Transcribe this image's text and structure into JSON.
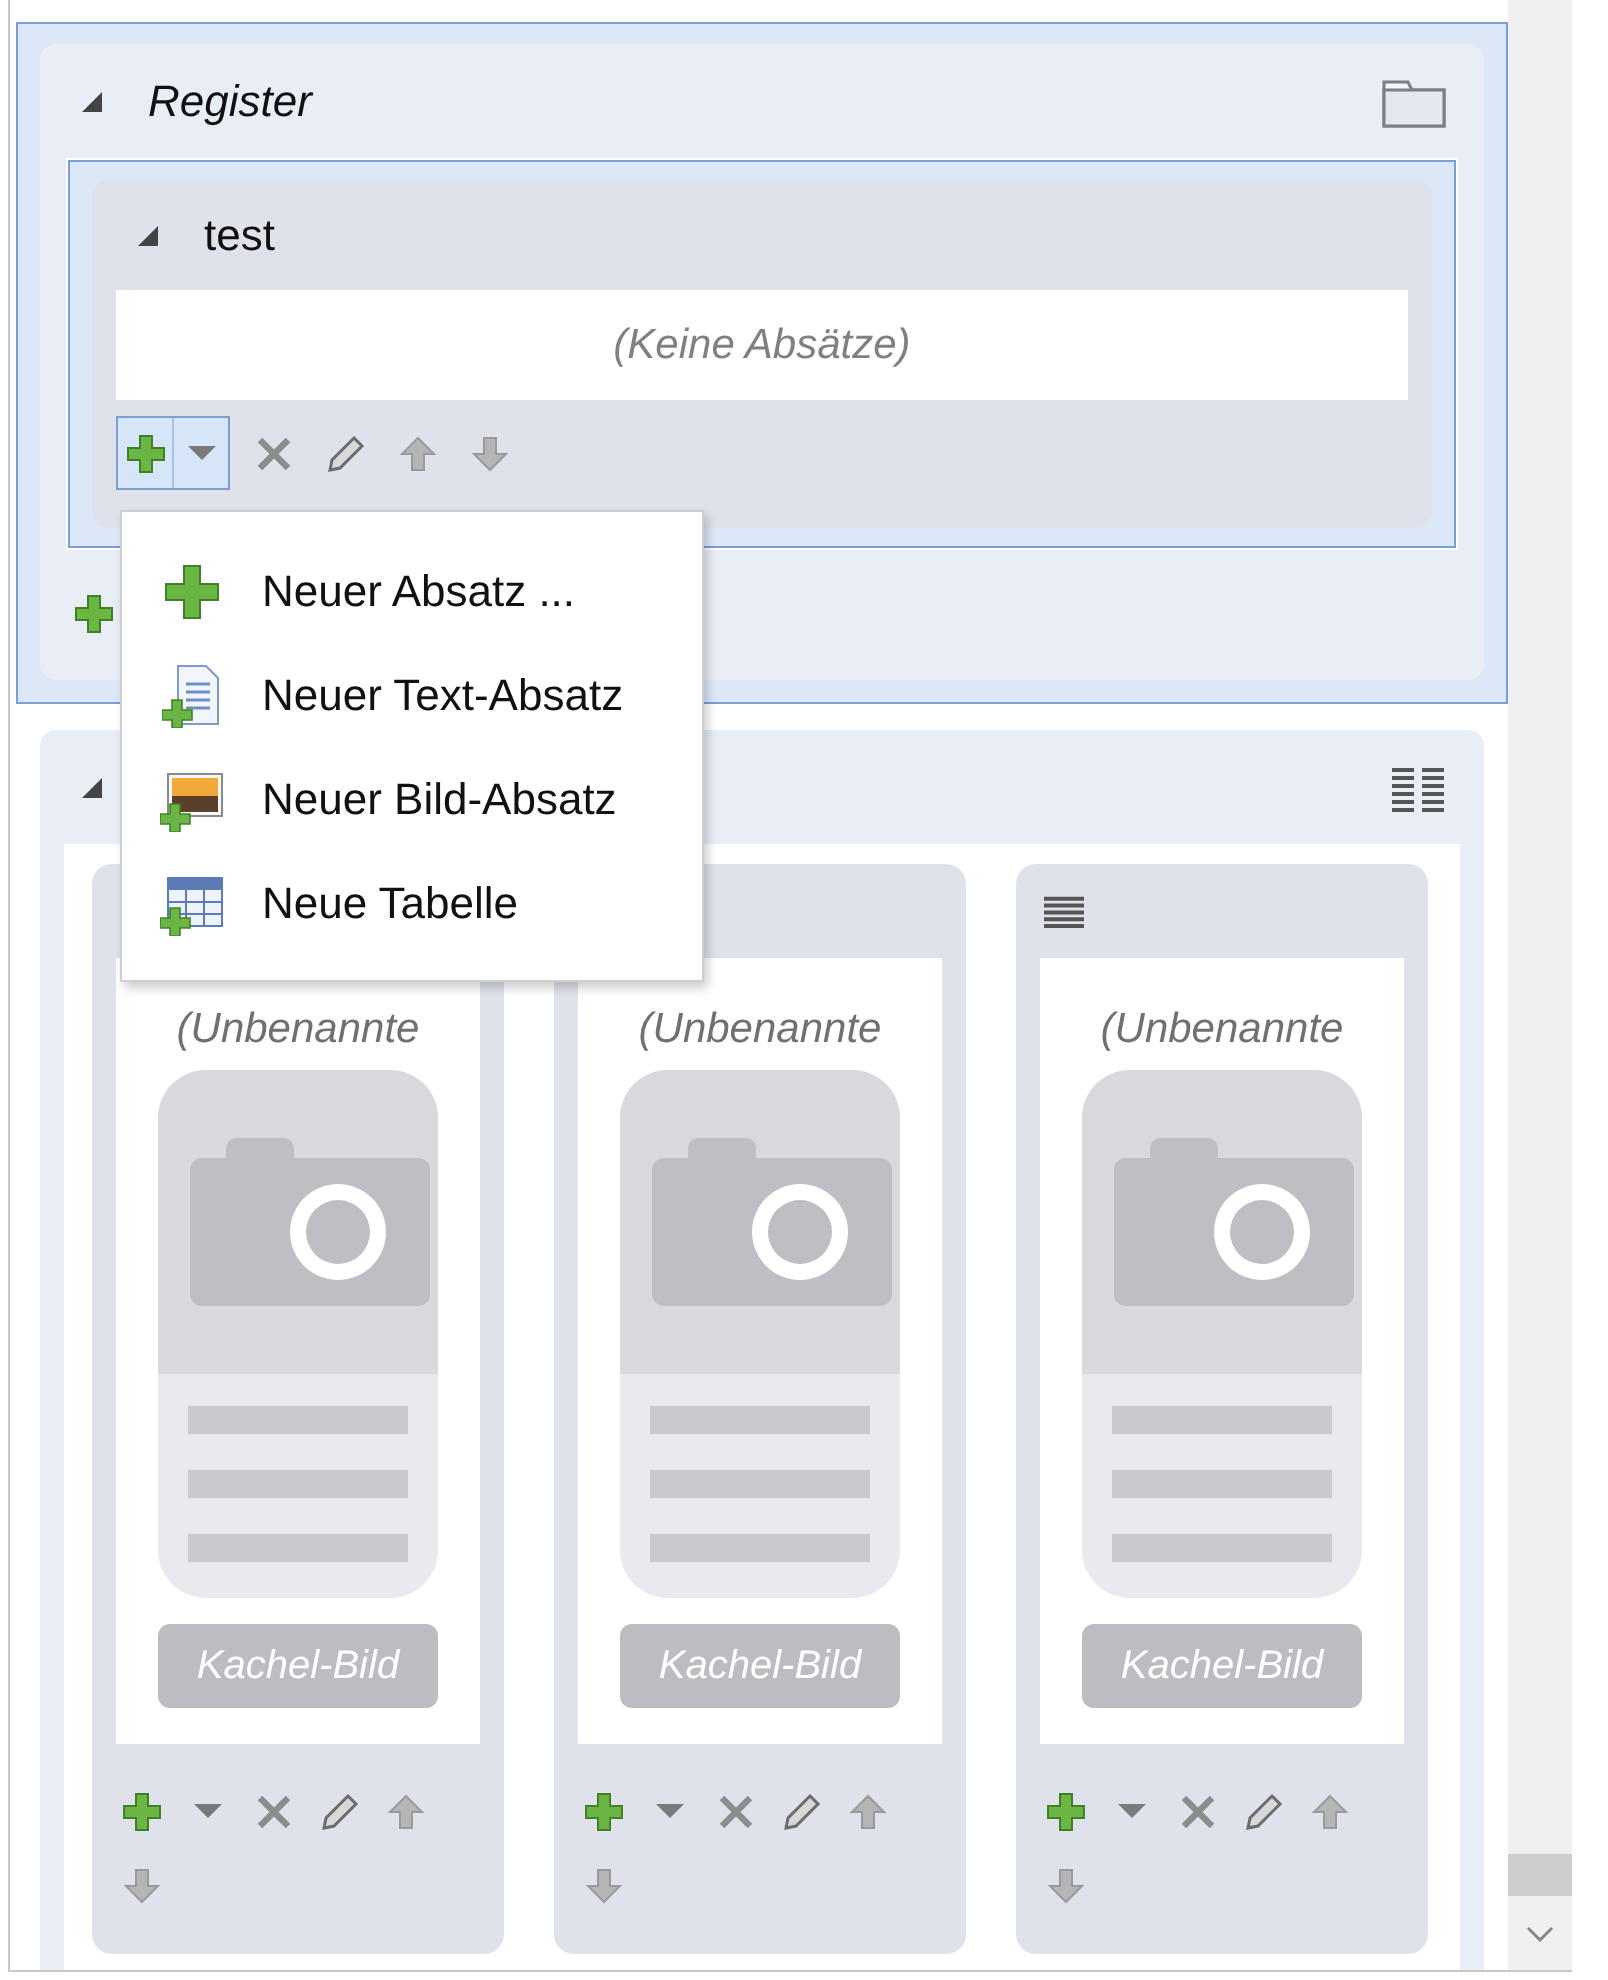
{
  "register": {
    "title": "Register",
    "expanded": true,
    "selected": true,
    "group": {
      "title": "test",
      "expanded": true,
      "selected": true,
      "empty_text": "(Keine Absätze)"
    }
  },
  "menu": {
    "open": true,
    "items": [
      {
        "label": "Neuer Absatz ...",
        "kind": "plus"
      },
      {
        "label": "Neuer Text-Absatz",
        "kind": "text"
      },
      {
        "label": "Neuer Bild-Absatz",
        "kind": "image"
      },
      {
        "label": "Neue Tabelle",
        "kind": "table"
      }
    ]
  },
  "tiles_section": {
    "expanded": true,
    "selected": false,
    "tiles": [
      {
        "title": "(Unbenannte",
        "image_label": "Kachel-Bild"
      },
      {
        "title": "(Unbenannte",
        "image_label": "Kachel-Bild"
      },
      {
        "title": "(Unbenannte",
        "image_label": "Kachel-Bild",
        "list_icon": true
      }
    ]
  }
}
